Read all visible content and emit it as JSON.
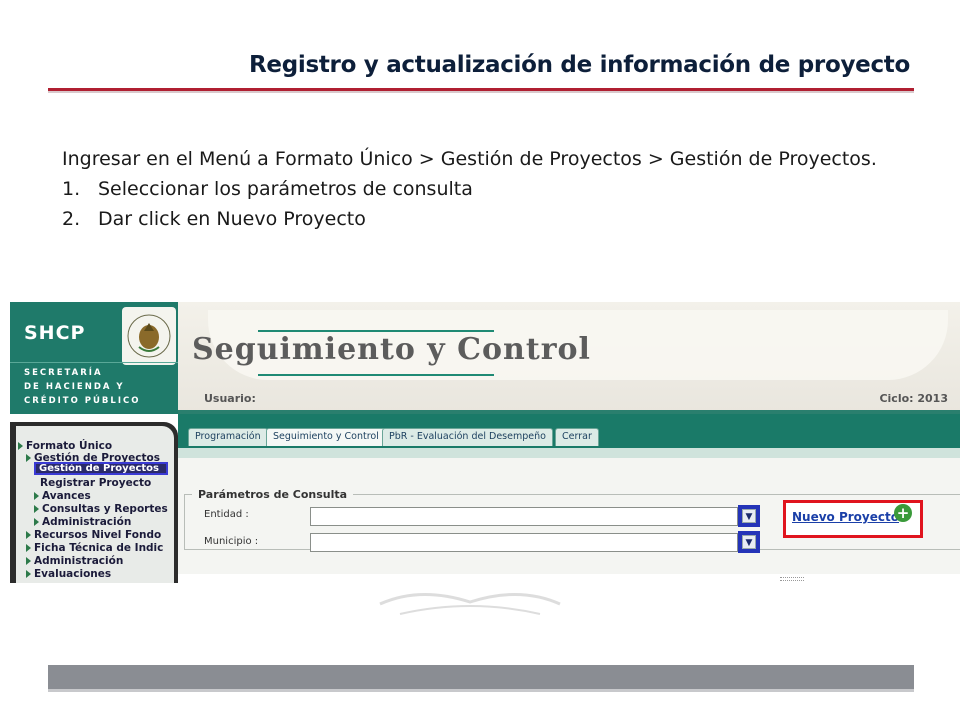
{
  "slide": {
    "title": "Registro y actualización de información de proyecto",
    "intro": "Ingresar en el Menú a Formato Único > Gestión de Proyectos > Gestión de Proyectos.",
    "steps": [
      {
        "num": "1.",
        "text": "Seleccionar los parámetros de consulta"
      },
      {
        "num": "2.",
        "text": "Dar click en Nuevo Proyecto"
      }
    ]
  },
  "app": {
    "logo": "SHCP",
    "org_lines": [
      "SECRETARÍA",
      "DE HACIENDA Y",
      "CRÉDITO PÚBLICO"
    ],
    "seal_text": "ESTADOS UNIDOS MEXICANOS",
    "banner_title": "Seguimiento y Control",
    "usuario_label": "Usuario:",
    "ciclo_label": "Ciclo: 2013",
    "tabs": [
      {
        "label": "Programación"
      },
      {
        "label": "Seguimiento y Control"
      },
      {
        "label": "PbR - Evaluación del Desempeño"
      },
      {
        "label": "Cerrar"
      }
    ],
    "sidebar": {
      "formato_unico": "Formato Único",
      "gestion_proyectos": "Gestión de Proyectos",
      "gestion_selected": "Gestión de Proyectos",
      "registrar": "Registrar Proyecto",
      "avances": "Avances",
      "consultas": "Consultas y Reportes",
      "administracion_sub": "Administración",
      "recursos": "Recursos Nivel Fondo",
      "ficha": "Ficha Técnica de Indic",
      "administracion": "Administración",
      "evaluaciones": "Evaluaciones"
    },
    "params": {
      "legend": "Parámetros de Consulta",
      "entidad_label": "Entidad :",
      "municipio_label": "Municipio :",
      "nuevo_label": "Nuevo Proyecto"
    }
  }
}
